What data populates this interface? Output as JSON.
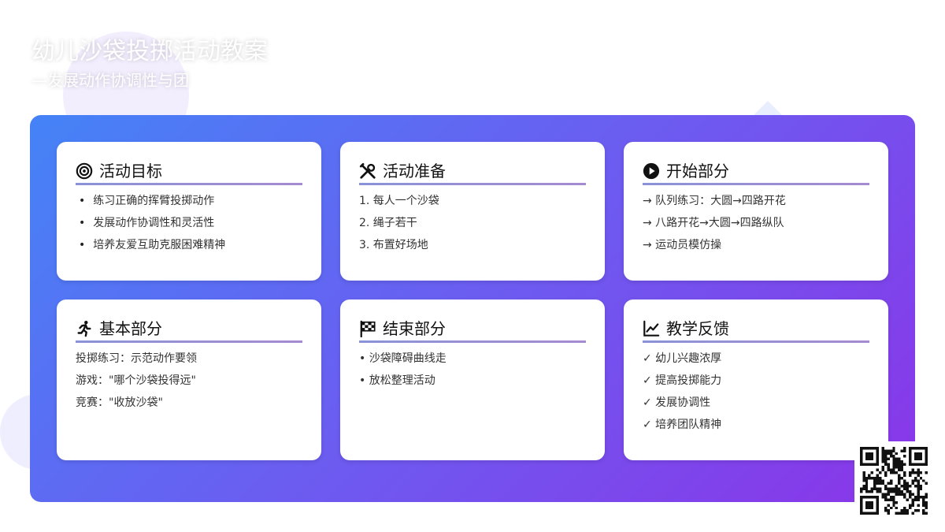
{
  "header": {
    "title": "幼儿沙袋投掷活动教案",
    "subtitle": "—发展动作协调性与团"
  },
  "cards": [
    {
      "icon": "target-icon",
      "title": "活动目标",
      "items": [
        "练习正确的挥臂投掷动作",
        "发展动作协调性和灵活性",
        "培养友爱互助克服困难精神"
      ]
    },
    {
      "icon": "tools-icon",
      "title": "活动准备",
      "items": [
        "1. 每人一个沙袋",
        "2. 绳子若干",
        "3. 布置好场地"
      ]
    },
    {
      "icon": "play-icon",
      "title": "开始部分",
      "items": [
        "→ 队列练习：大圆→四路开花",
        "→ 八路开花→大圆→四路纵队",
        "→ 运动员模仿操"
      ]
    },
    {
      "icon": "running-icon",
      "title": "基本部分",
      "items": [
        "投掷练习：示范动作要领",
        "游戏：\"哪个沙袋投得远\"",
        "竞赛：\"收放沙袋\""
      ]
    },
    {
      "icon": "checkered-flag-icon",
      "title": "结束部分",
      "items": [
        "• 沙袋障碍曲线走",
        "• 放松整理活动"
      ]
    },
    {
      "icon": "chart-line-icon",
      "title": "教学反馈",
      "items": [
        "✓ 幼儿兴趣浓厚",
        "✓ 提高投掷能力",
        "✓ 发展协调性",
        "✓ 培养团队精神"
      ]
    }
  ],
  "qr": {
    "icon": "qr-code-icon"
  }
}
